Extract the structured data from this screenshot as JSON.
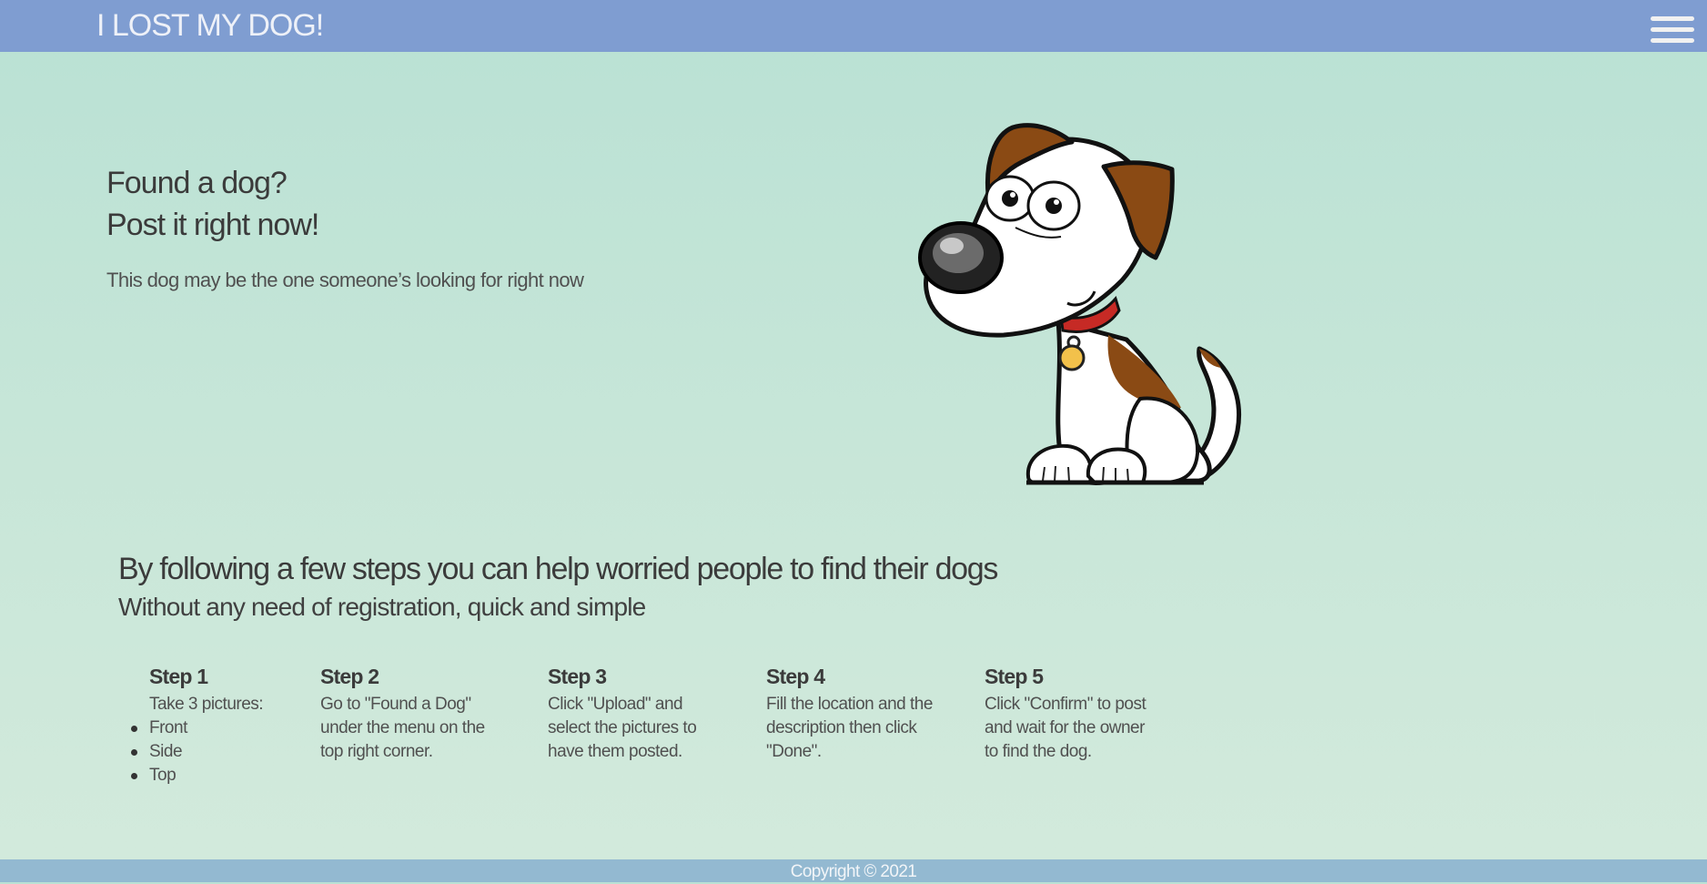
{
  "header": {
    "brand": "I LOST MY DOG!",
    "menu_icon": "hamburger-menu-icon"
  },
  "hero": {
    "heading_line1": "Found a dog?",
    "heading_line2": "Post it right now!",
    "subtitle": "This dog may be the one someone’s looking for right now",
    "illustration": "cartoon-dog-illustration"
  },
  "steps_section": {
    "title": "By following a few steps you can help worried people to find their dogs",
    "subtitle": "Without any need of registration, quick and simple",
    "steps": [
      {
        "title": "Step 1",
        "text": "Take 3 pictures:",
        "bullets": [
          "Front",
          "Side",
          "Top"
        ]
      },
      {
        "title": "Step 2",
        "text_lines": [
          "Go to \"Found a Dog\"",
          "under the menu on the",
          "top right corner."
        ]
      },
      {
        "title": "Step 3",
        "text_lines": [
          "Click \"Upload\" and",
          "select the pictures to",
          "have them posted."
        ]
      },
      {
        "title": "Step 4",
        "text_lines": [
          "Fill the location and the",
          "description then click",
          "\"Done\"."
        ]
      },
      {
        "title": "Step 5",
        "text_lines": [
          "Click \"Confirm\" to post",
          "and wait for the owner",
          "to find the dog."
        ]
      }
    ]
  },
  "footer": {
    "copyright": "Copyright © 2021"
  },
  "colors": {
    "header_bg": "#7f9dd1",
    "footer_bg": "#93b9d1",
    "page_bg_top": "#b9e1d4",
    "page_bg_bottom": "#d3eadc"
  }
}
